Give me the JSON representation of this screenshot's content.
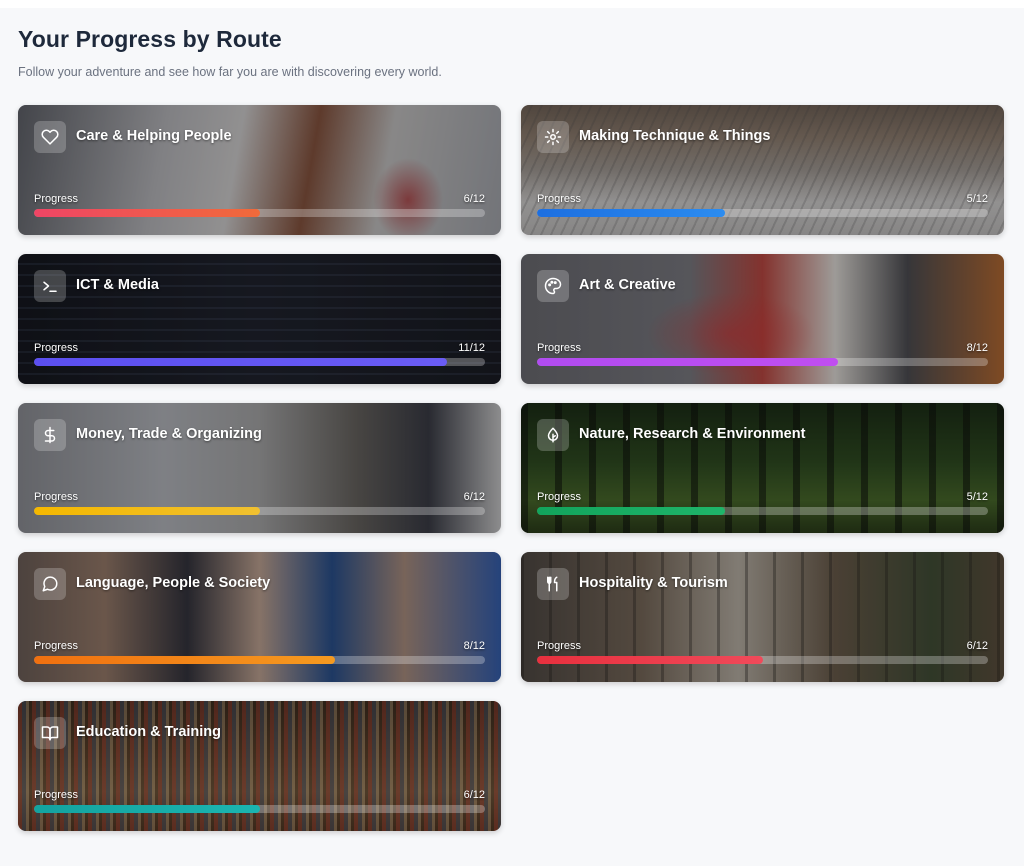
{
  "header": {
    "title": "Your Progress by Route",
    "subtitle": "Follow your adventure and see how far you are with discovering every world."
  },
  "progress_label": "Progress",
  "routes": [
    {
      "name": "Care & Helping People",
      "icon": "heart-icon",
      "progress": "6/12",
      "completed": 6,
      "total": 12,
      "color": "#ef4565",
      "color2": "#f06a3a"
    },
    {
      "name": "Making Technique & Things",
      "icon": "gear-icon",
      "progress": "5/12",
      "completed": 5,
      "total": 12,
      "color": "#1d6fe0",
      "color2": "#2b8cf0"
    },
    {
      "name": "ICT & Media",
      "icon": "terminal-icon",
      "progress": "11/12",
      "completed": 11,
      "total": 12,
      "color": "#5b4ff0",
      "color2": "#6a5cf5"
    },
    {
      "name": "Art & Creative",
      "icon": "palette-icon",
      "progress": "8/12",
      "completed": 8,
      "total": 12,
      "color": "#b14cf0",
      "color2": "#c04ef0"
    },
    {
      "name": "Money, Trade & Organizing",
      "icon": "dollar-icon",
      "progress": "6/12",
      "completed": 6,
      "total": 12,
      "color": "#f5b800",
      "color2": "#f0c030"
    },
    {
      "name": "Nature, Research & Environment",
      "icon": "leaf-icon",
      "progress": "5/12",
      "completed": 5,
      "total": 12,
      "color": "#12a45c",
      "color2": "#1fb56a"
    },
    {
      "name": "Language, People & Society",
      "icon": "chat-bubble-icon",
      "progress": "8/12",
      "completed": 8,
      "total": 12,
      "color": "#f07010",
      "color2": "#f59a20"
    },
    {
      "name": "Hospitality & Tourism",
      "icon": "utensils-icon",
      "progress": "6/12",
      "completed": 6,
      "total": 12,
      "color": "#e8303e",
      "color2": "#f04a5a"
    },
    {
      "name": "Education & Training",
      "icon": "book-icon",
      "progress": "6/12",
      "completed": 6,
      "total": 12,
      "color": "#14a3a0",
      "color2": "#1bb5b0"
    }
  ]
}
